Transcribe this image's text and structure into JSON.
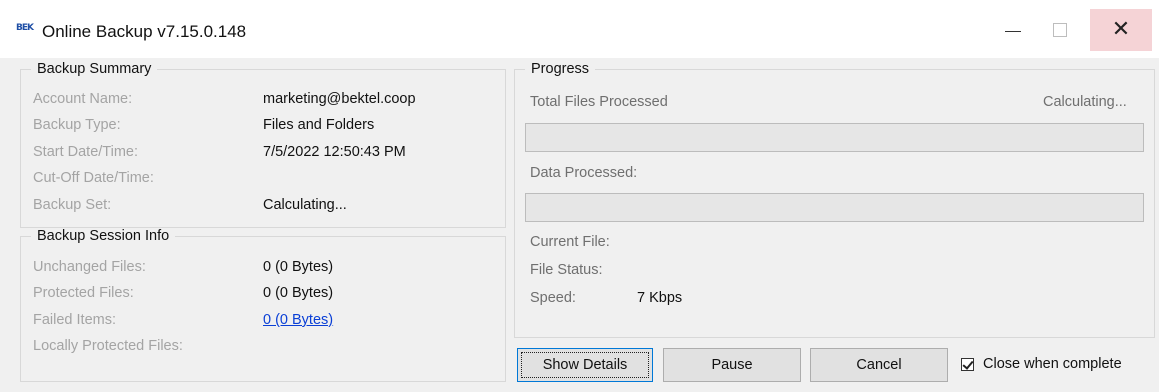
{
  "window": {
    "title": "Online Backup v7.15.0.148",
    "icon": "bektel-logo-icon",
    "logo_text": "BEK"
  },
  "backup_summary": {
    "legend": "Backup Summary",
    "rows": [
      {
        "label": "Account Name:",
        "value": "marketing@bektel.coop"
      },
      {
        "label": "Backup Type:",
        "value": "Files and Folders"
      },
      {
        "label": "Start Date/Time:",
        "value": "7/5/2022 12:50:43 PM"
      },
      {
        "label": "Cut-Off Date/Time:",
        "value": ""
      },
      {
        "label": "Backup Set:",
        "value": "Calculating..."
      }
    ]
  },
  "session_info": {
    "legend": "Backup Session Info",
    "rows": [
      {
        "label": "Unchanged Files:",
        "value": "0 (0 Bytes)"
      },
      {
        "label": "Protected Files:",
        "value": "0 (0 Bytes)"
      },
      {
        "label": "Failed Items:",
        "value": "0 (0 Bytes)",
        "link": true
      },
      {
        "label": "Locally Protected Files:",
        "value": ""
      }
    ]
  },
  "progress": {
    "legend": "Progress",
    "total_files_label": "Total Files Processed",
    "total_files_value": "Calculating...",
    "files_progress": 0,
    "data_processed_label": "Data Processed:",
    "data_progress": 0,
    "current_file_label": "Current File:",
    "current_file_value": "",
    "file_status_label": "File Status:",
    "file_status_value": "",
    "speed_label": "Speed:",
    "speed_value": "7 Kbps"
  },
  "buttons": {
    "show_details": "Show Details",
    "pause": "Pause",
    "cancel": "Cancel"
  },
  "close_when_complete": {
    "label": "Close when complete",
    "checked": true
  },
  "colors": {
    "close_hover": "#f5d3d6",
    "link": "#0a3fd6",
    "disabled_label": "#a4a4a4",
    "progress_track": "#e6e6e6"
  }
}
